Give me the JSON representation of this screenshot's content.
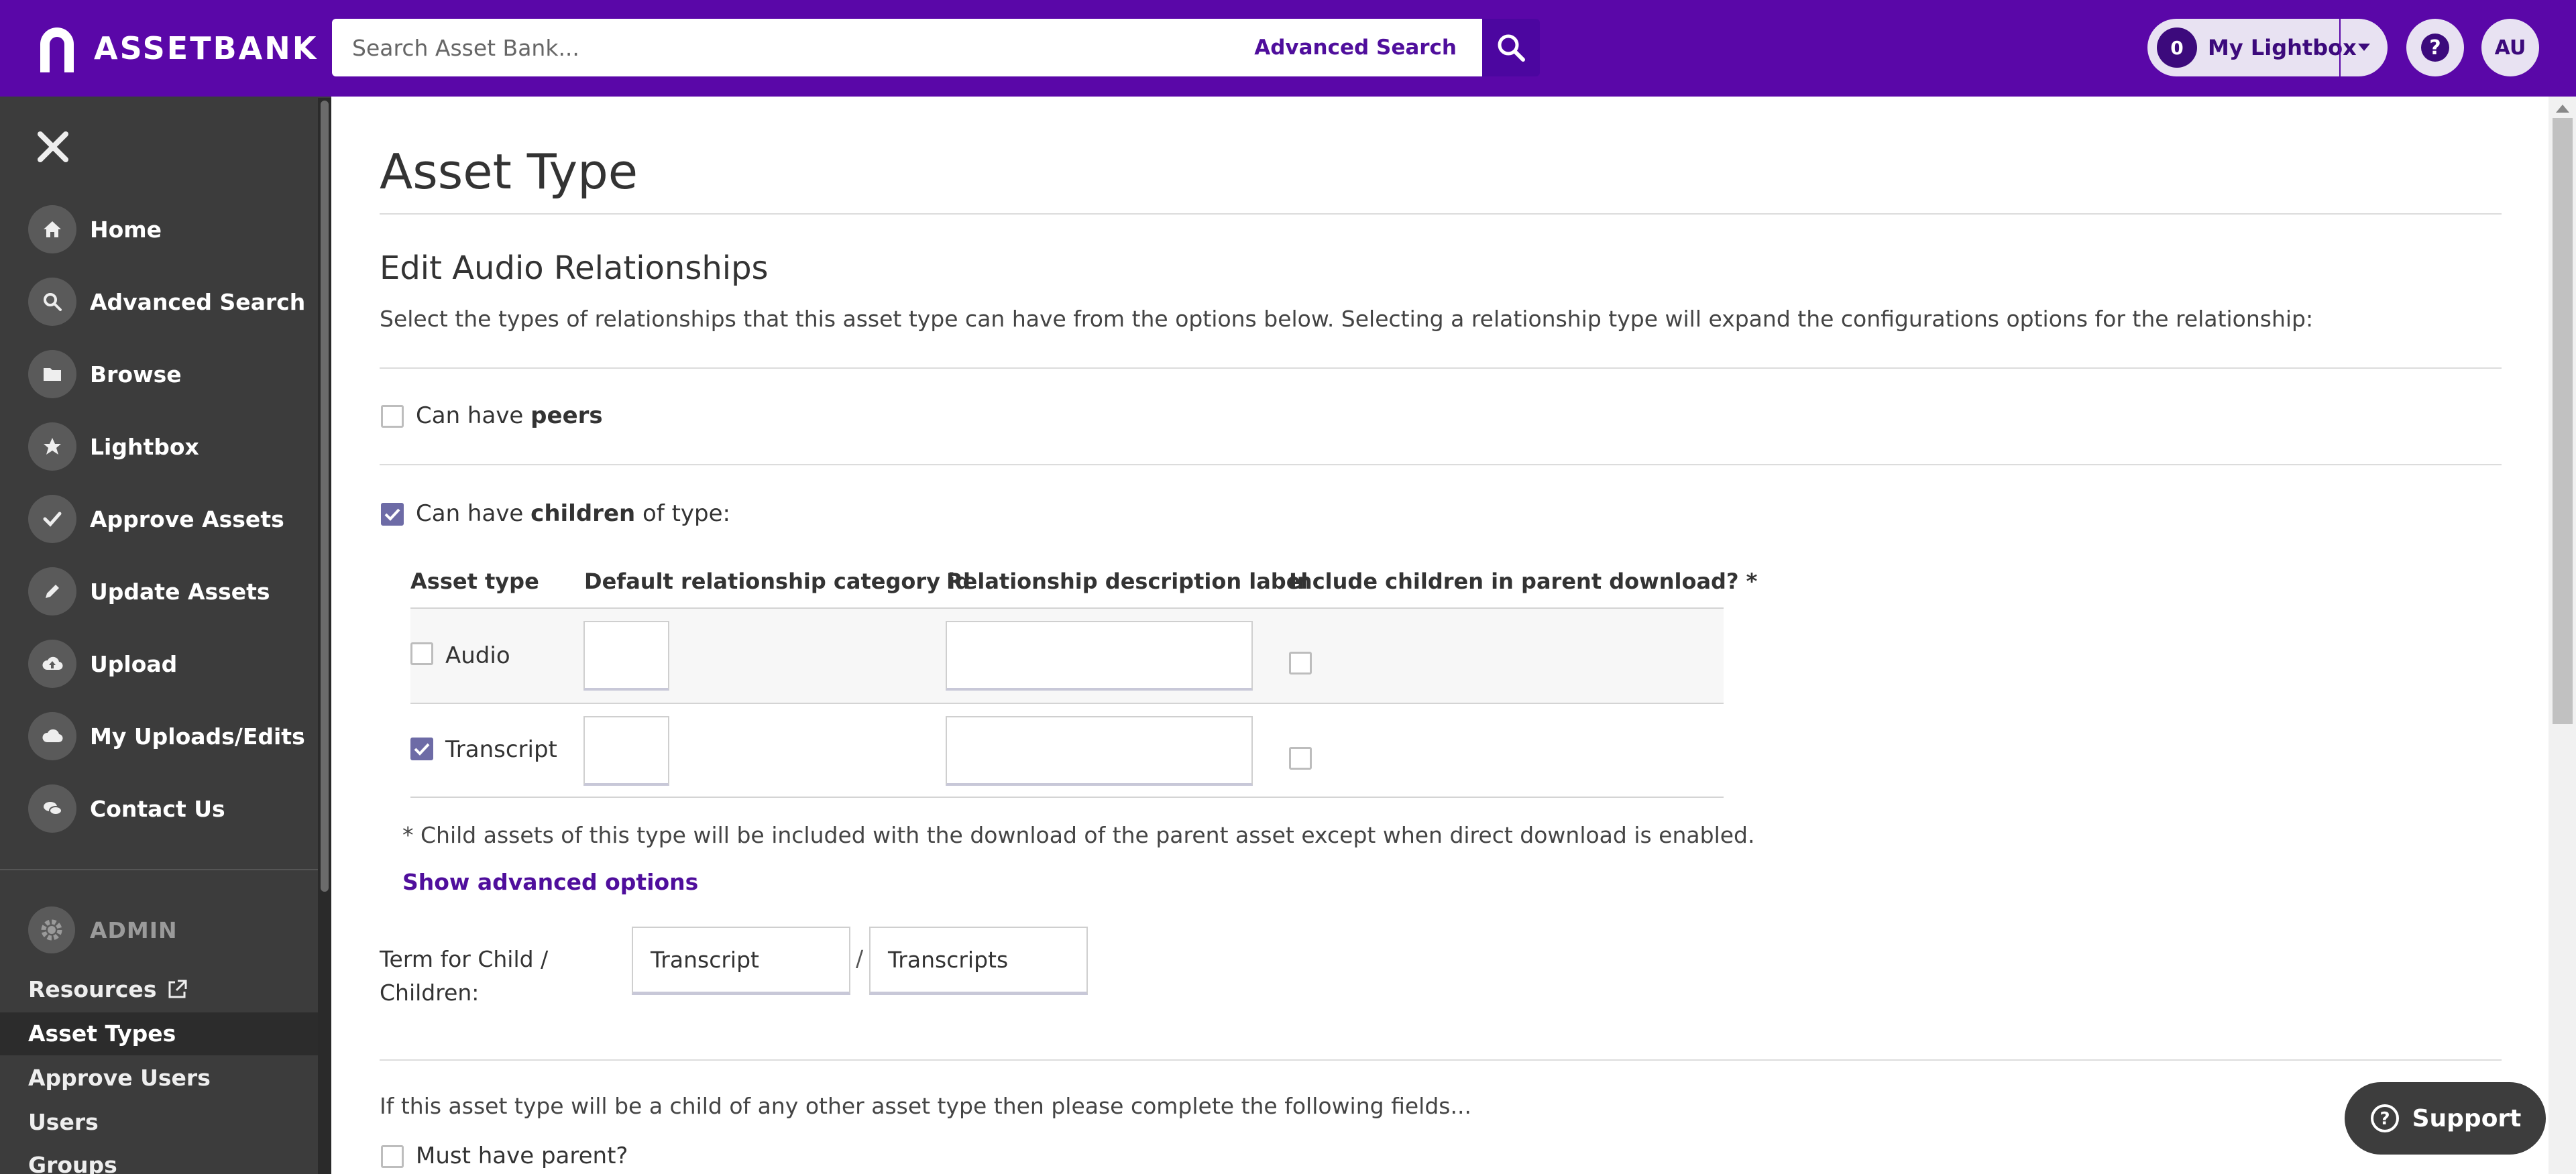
{
  "header": {
    "logo_text": "ASSETBANK",
    "search_placeholder": "Search Asset Bank...",
    "advanced_search": "Advanced Search",
    "lightbox_count": "0",
    "lightbox_label": "My Lightbox",
    "avatar_initials": "AU"
  },
  "sidebar": {
    "nav": [
      {
        "label": "Home",
        "icon": "home-icon"
      },
      {
        "label": "Advanced Search",
        "icon": "search-icon"
      },
      {
        "label": "Browse",
        "icon": "folder-icon"
      },
      {
        "label": "Lightbox",
        "icon": "star-icon"
      },
      {
        "label": "Approve Assets",
        "icon": "check-icon"
      },
      {
        "label": "Update Assets",
        "icon": "pencil-icon"
      },
      {
        "label": "Upload",
        "icon": "cloud-upload-icon"
      },
      {
        "label": "My Uploads/Edits",
        "icon": "cloud-icon"
      },
      {
        "label": "Contact Us",
        "icon": "chat-icon"
      }
    ],
    "admin_label": "ADMIN",
    "admin_links": [
      "Resources",
      "Asset Types",
      "Approve Users",
      "Users",
      "Groups"
    ]
  },
  "main": {
    "page_title": "Asset Type",
    "section_title": "Edit Audio Relationships",
    "intro": "Select the types of relationships that this asset type can have from the options below. Selecting a relationship type will expand the configurations options for the relationship:",
    "peers": {
      "prefix": "Can have ",
      "bold": "peers",
      "suffix": "",
      "checked": false
    },
    "children": {
      "prefix": "Can have ",
      "bold": "children",
      "suffix": " of type:",
      "checked": true
    },
    "table": {
      "headers": [
        "Asset type",
        "Default relationship category id",
        "Relationship description label",
        "Include children in parent download? *"
      ],
      "rows": [
        {
          "name": "Audio",
          "checked": false,
          "category_id": "",
          "label": "",
          "include": false
        },
        {
          "name": "Transcript",
          "checked": true,
          "category_id": "",
          "label": "",
          "include": false
        }
      ]
    },
    "note": "* Child assets of this type will be included with the download of the parent asset except when direct download is enabled.",
    "show_advanced": "Show advanced options",
    "term_label_line1": "Term for Child /",
    "term_label_line2": "Children:",
    "term_singular": "Transcript",
    "term_plural": "Transcripts",
    "slash": "/",
    "child_text": "If this asset type will be a child of any other asset type then please complete the following fields...",
    "must_have_parent": "Must have parent?"
  },
  "support_label": "Support",
  "colors": {
    "brand": "#5a07a8",
    "sidebar": "#3c3c3c",
    "link": "#4f0e9c",
    "checkbox": "#6d6ba6"
  }
}
